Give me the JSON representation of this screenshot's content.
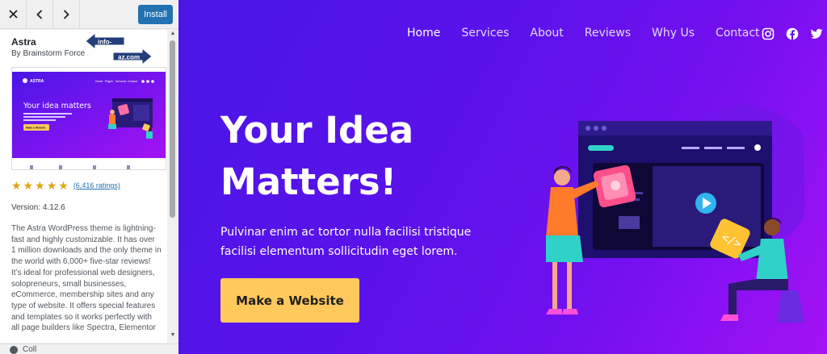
{
  "panel": {
    "install_label": "Install",
    "theme": {
      "name": "Astra",
      "author": "By Brainstorm Force",
      "rating_count": "(6,416 ratings)",
      "stars": 5,
      "version": "Version: 4.12.6",
      "description": "The Astra WordPress theme is lightning-fast and highly customizable. It has over 1 million downloads and the only theme in the world with 6,000+ five-star reviews! It’s ideal for professional web designers, solopreneurs, small businesses, eCommerce, membership sites and any type of website. It offers special features and templates so it works perfectly with all page builders like Spectra, Elementor"
    },
    "watermark": {
      "left": "info-",
      "right": "az.com"
    },
    "collapse_label": "Coll",
    "thumbnail": {
      "logo_text": "ASTRA",
      "headline": "Your idea matters",
      "nav": [
        "Home",
        "Pages",
        "Services",
        "Contact"
      ],
      "button": "Make a Website"
    }
  },
  "preview": {
    "nav": [
      "Home",
      "Services",
      "About",
      "Reviews",
      "Why Us",
      "Contact"
    ],
    "social_icons": [
      "instagram-icon",
      "facebook-icon",
      "twitter-icon"
    ],
    "hero": {
      "title": "Your Idea Matters!",
      "subtitle": "Pulvinar enim ac tortor nulla facilisi tristique facilisi elementum sollicitudin eget lorem.",
      "cta_label": "Make a Website"
    }
  },
  "colors": {
    "accent": "#2271b1",
    "cta": "#ffc95c",
    "gradient_start": "#4a16e8",
    "gradient_end": "#a412f4",
    "star": "#dba617"
  }
}
